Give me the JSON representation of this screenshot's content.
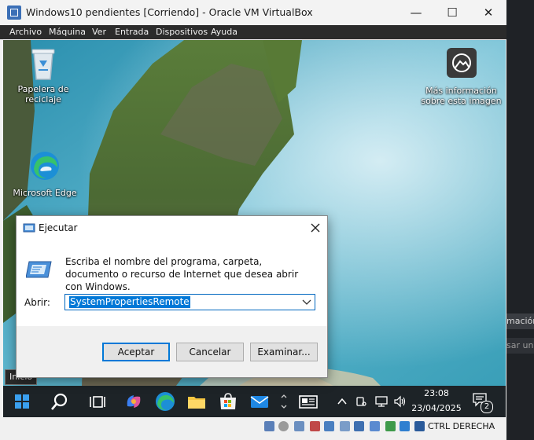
{
  "window": {
    "title": "Windows10 pendientes [Corriendo] - Oracle VM VirtualBox",
    "minimize_glyph": "—",
    "maximize_glyph": "☐",
    "close_glyph": "✕"
  },
  "menu": {
    "items": [
      "Archivo",
      "Máquina",
      "Ver",
      "Entrada",
      "Dispositivos",
      "Ayuda"
    ]
  },
  "desktop": {
    "recycle_bin_label": "Papelera de reciclaje",
    "edge_label": "Microsoft Edge",
    "more_info_label": "Más información sobre esta imagen"
  },
  "run_dialog": {
    "title": "Ejecutar",
    "description": "Escriba el nombre del programa, carpeta, documento o recurso de Internet que desea abrir con Windows.",
    "open_label": "Abrir:",
    "open_value": "SystemPropertiesRemote",
    "accept_button": "Aceptar",
    "cancel_button": "Cancelar",
    "browse_button": "Examinar..."
  },
  "tooltip": {
    "text": "Inicio"
  },
  "taskbar": {
    "time": "23:08",
    "date": "23/04/2025",
    "notification_count": "2"
  },
  "statusbar": {
    "host_key": "CTRL DERECHA"
  },
  "background_peek": {
    "line1": "mación",
    "line2": "sar un r"
  },
  "colors": {
    "accent": "#0078d7",
    "taskbar": "#1d2327",
    "menubar": "#2b2b2b"
  }
}
